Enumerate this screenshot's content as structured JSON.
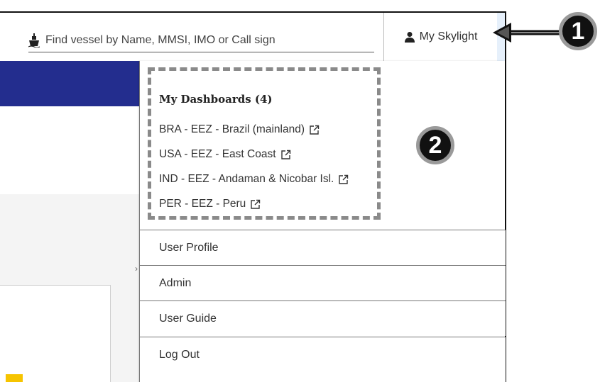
{
  "header": {
    "search_placeholder": "Find vessel by Name, MMSI, IMO or Call sign",
    "account_button_label": "My Skylight"
  },
  "dropdown": {
    "dashboards_title": "My Dashboards (4)",
    "dashboards": [
      {
        "label": "BRA - EEZ - Brazil (mainland)"
      },
      {
        "label": "USA - EEZ - East Coast"
      },
      {
        "label": "IND - EEZ - Andaman & Nicobar Isl."
      },
      {
        "label": "PER - EEZ - Peru"
      }
    ],
    "menu": [
      {
        "label": "User Profile"
      },
      {
        "label": "Admin"
      },
      {
        "label": "User Guide"
      },
      {
        "label": "Log Out"
      }
    ]
  },
  "callouts": {
    "one": "1",
    "two": "2"
  },
  "colors": {
    "nav_band": "#232d8e",
    "accent_yellow": "#f6c400",
    "callout_fill": "#111111",
    "callout_border": "#9a9a9a"
  },
  "icons": {
    "search": "ship-icon",
    "account": "person-icon",
    "dashboard_link": "external-link-icon"
  }
}
